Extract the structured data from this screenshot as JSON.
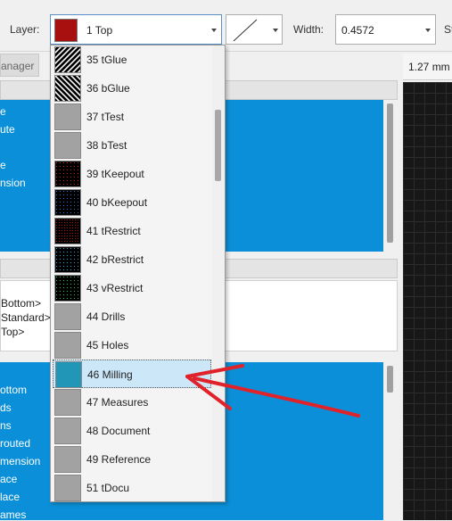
{
  "toolbar": {
    "layer_label": "Layer:",
    "layer_value": "1 Top",
    "width_label": "Width:",
    "width_value": "0.4572",
    "trailing_label": "St"
  },
  "tab": {
    "label": "anager"
  },
  "grid": {
    "unit_label": "1.27 mm"
  },
  "top_panel": {
    "rows": [
      "e",
      "ute",
      "",
      "e",
      "nsion",
      "",
      ""
    ]
  },
  "middle_panel": {
    "rows": [
      "Bottom>",
      "Standard>",
      "Top>"
    ]
  },
  "bottom_panel": {
    "rows": [
      "",
      "ottom",
      "ds",
      "ns",
      "routed",
      "mension",
      "ace",
      "lace",
      "ames"
    ]
  },
  "layer_dropdown": {
    "items": [
      {
        "label": "35 tGlue",
        "pattern": "hatch-black"
      },
      {
        "label": "36 bGlue",
        "pattern": "hatch-black-rev"
      },
      {
        "label": "37 tTest",
        "pattern": "gray"
      },
      {
        "label": "38 bTest",
        "pattern": "gray"
      },
      {
        "label": "39 tKeepout",
        "pattern": "dots-red"
      },
      {
        "label": "40 bKeepout",
        "pattern": "dots-blue"
      },
      {
        "label": "41 tRestrict",
        "pattern": "dots-red-fine"
      },
      {
        "label": "42 bRestrict",
        "pattern": "dots-cyan"
      },
      {
        "label": "43 vRestrict",
        "pattern": "dots-green"
      },
      {
        "label": "44 Drills",
        "pattern": "gray"
      },
      {
        "label": "45 Holes",
        "pattern": "gray"
      },
      {
        "label": "46 Milling",
        "pattern": "teal"
      },
      {
        "label": "47 Measures",
        "pattern": "gray"
      },
      {
        "label": "48 Document",
        "pattern": "gray"
      },
      {
        "label": "49 Reference",
        "pattern": "gray"
      },
      {
        "label": "51 tDocu",
        "pattern": "gray"
      }
    ],
    "selected_label": "46 Milling"
  },
  "colors": {
    "accent_blue": "#0b8fd8",
    "layer_swatch": "#a80f0f",
    "selected_row": "#cce8f8",
    "milling_teal": "#2196b6",
    "annotation_arrow": "#e0222a"
  }
}
